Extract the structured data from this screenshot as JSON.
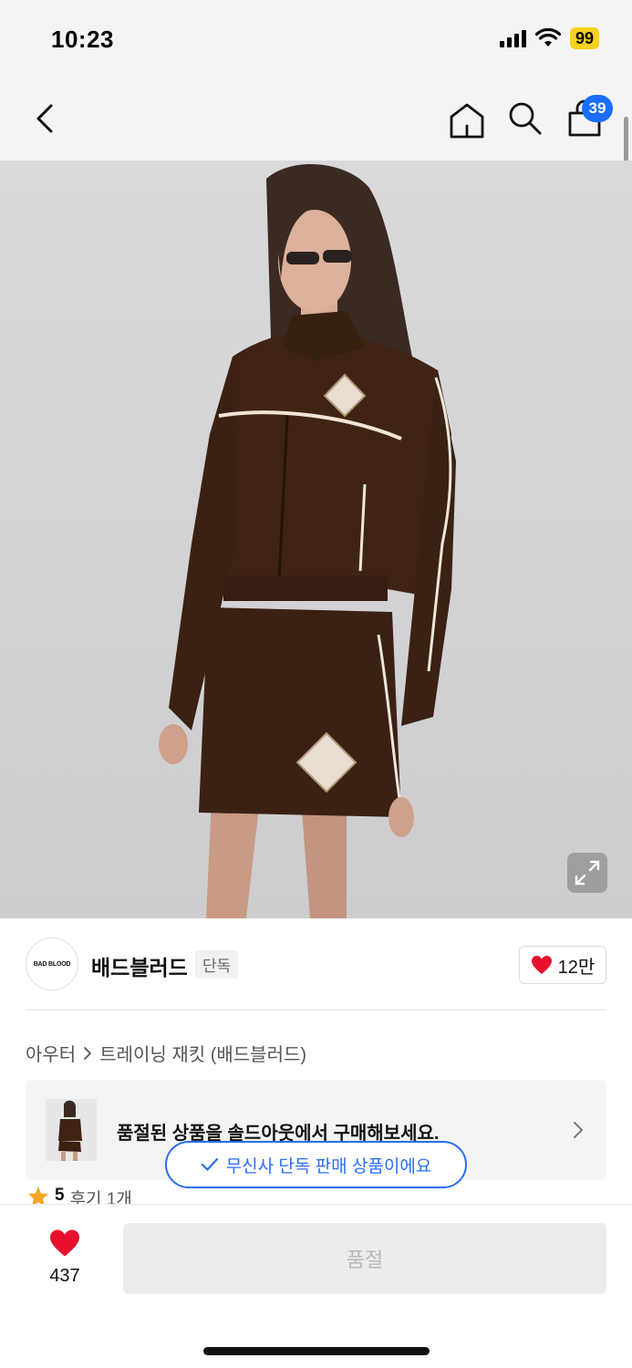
{
  "status": {
    "time": "10:23",
    "battery": "99"
  },
  "nav": {
    "cart_count": "39"
  },
  "brand": {
    "logo_text": "BAD BLOOD",
    "name": "배드블러드",
    "tag": "단독",
    "likes": "12만"
  },
  "breadcrumb": {
    "category": "아우터",
    "separator": ">",
    "product": "트레이닝 재킷 (배드블러드)"
  },
  "soldout": {
    "message": "품절된 상품을 솔드아웃에서 구매해보세요."
  },
  "toast": {
    "message": "무신사 단독 판매 상품이에요"
  },
  "review": {
    "score": "5",
    "count_text": "후기 1개"
  },
  "bottom": {
    "wish_count": "437",
    "buy_label": "품절"
  },
  "colors": {
    "accent_blue": "#2a6df4",
    "heart_red": "#e8112d",
    "battery_yellow": "#f5d21f",
    "velvet_brown": "#3f2416"
  }
}
